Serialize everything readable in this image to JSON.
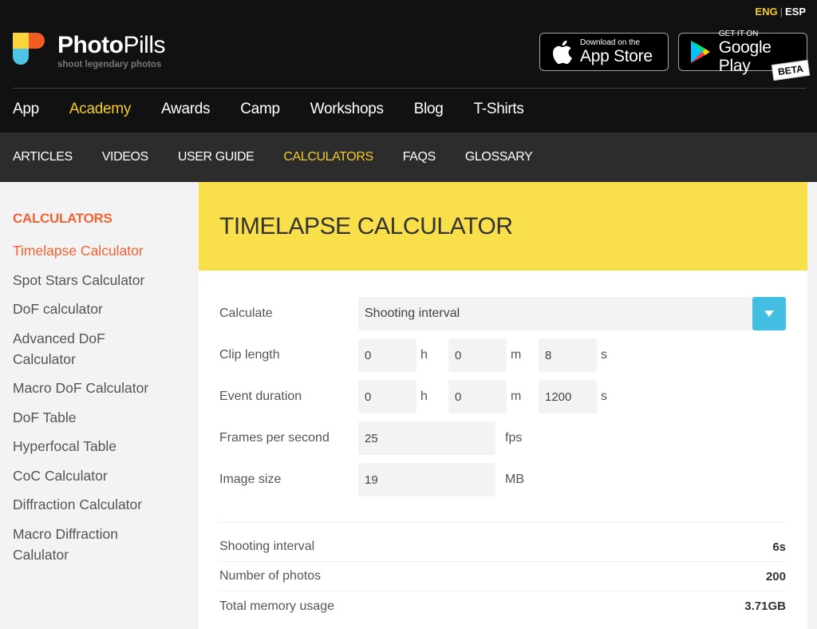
{
  "header": {
    "languages": [
      {
        "label": "ENG",
        "active": true
      },
      {
        "label": "ESP",
        "active": false
      }
    ],
    "language_separator": "|",
    "logo": {
      "name_bold": "Photo",
      "name_light": "Pills",
      "tagline": "shoot legendary photos"
    },
    "app_store": {
      "small": "Download on the",
      "big": "App Store"
    },
    "google_play": {
      "small": "GET IT ON",
      "big": "Google Play",
      "badge": "BETA"
    },
    "main_nav": [
      {
        "label": "App",
        "active": false
      },
      {
        "label": "Academy",
        "active": true
      },
      {
        "label": "Awards",
        "active": false
      },
      {
        "label": "Camp",
        "active": false
      },
      {
        "label": "Workshops",
        "active": false
      },
      {
        "label": "Blog",
        "active": false
      },
      {
        "label": "T-Shirts",
        "active": false
      }
    ],
    "sub_nav": [
      {
        "label": "ARTICLES",
        "active": false
      },
      {
        "label": "VIDEOS",
        "active": false
      },
      {
        "label": "USER GUIDE",
        "active": false
      },
      {
        "label": "CALCULATORS",
        "active": true
      },
      {
        "label": "FAQS",
        "active": false
      },
      {
        "label": "GLOSSARY",
        "active": false
      }
    ]
  },
  "sidebar": {
    "title": "CALCULATORS",
    "items": [
      {
        "label": "Timelapse Calculator",
        "active": true
      },
      {
        "label": "Spot Stars Calculator",
        "active": false
      },
      {
        "label": "DoF calculator",
        "active": false
      },
      {
        "label": "Advanced DoF Calculator",
        "active": false
      },
      {
        "label": "Macro DoF Calculator",
        "active": false
      },
      {
        "label": "DoF Table",
        "active": false
      },
      {
        "label": "Hyperfocal Table",
        "active": false
      },
      {
        "label": "CoC Calculator",
        "active": false
      },
      {
        "label": "Diffraction Calculator",
        "active": false
      },
      {
        "label": "Macro Diffraction Calulator",
        "active": false
      }
    ]
  },
  "calculator": {
    "title": "TIMELAPSE CALCULATOR",
    "calculate": {
      "label": "Calculate",
      "selected": "Shooting interval"
    },
    "clip_length": {
      "label": "Clip length",
      "h": "0",
      "m": "0",
      "s": "8"
    },
    "event_duration": {
      "label": "Event duration",
      "h": "0",
      "m": "0",
      "s": "1200"
    },
    "fps": {
      "label": "Frames per second",
      "value": "25",
      "unit": "fps"
    },
    "image_size": {
      "label": "Image size",
      "value": "19",
      "unit": "MB"
    },
    "units": {
      "h": "h",
      "m": "m",
      "s": "s"
    },
    "results": [
      {
        "label": "Shooting interval",
        "value": "6s"
      },
      {
        "label": "Number of photos",
        "value": "200"
      },
      {
        "label": "Total memory usage",
        "value": "3.71GB"
      }
    ]
  },
  "colors": {
    "accent_yellow": "#f2cb2f",
    "banner_yellow": "#f9e04b",
    "sidebar_active": "#f06332",
    "dropdown_blue": "#43bfe3"
  }
}
